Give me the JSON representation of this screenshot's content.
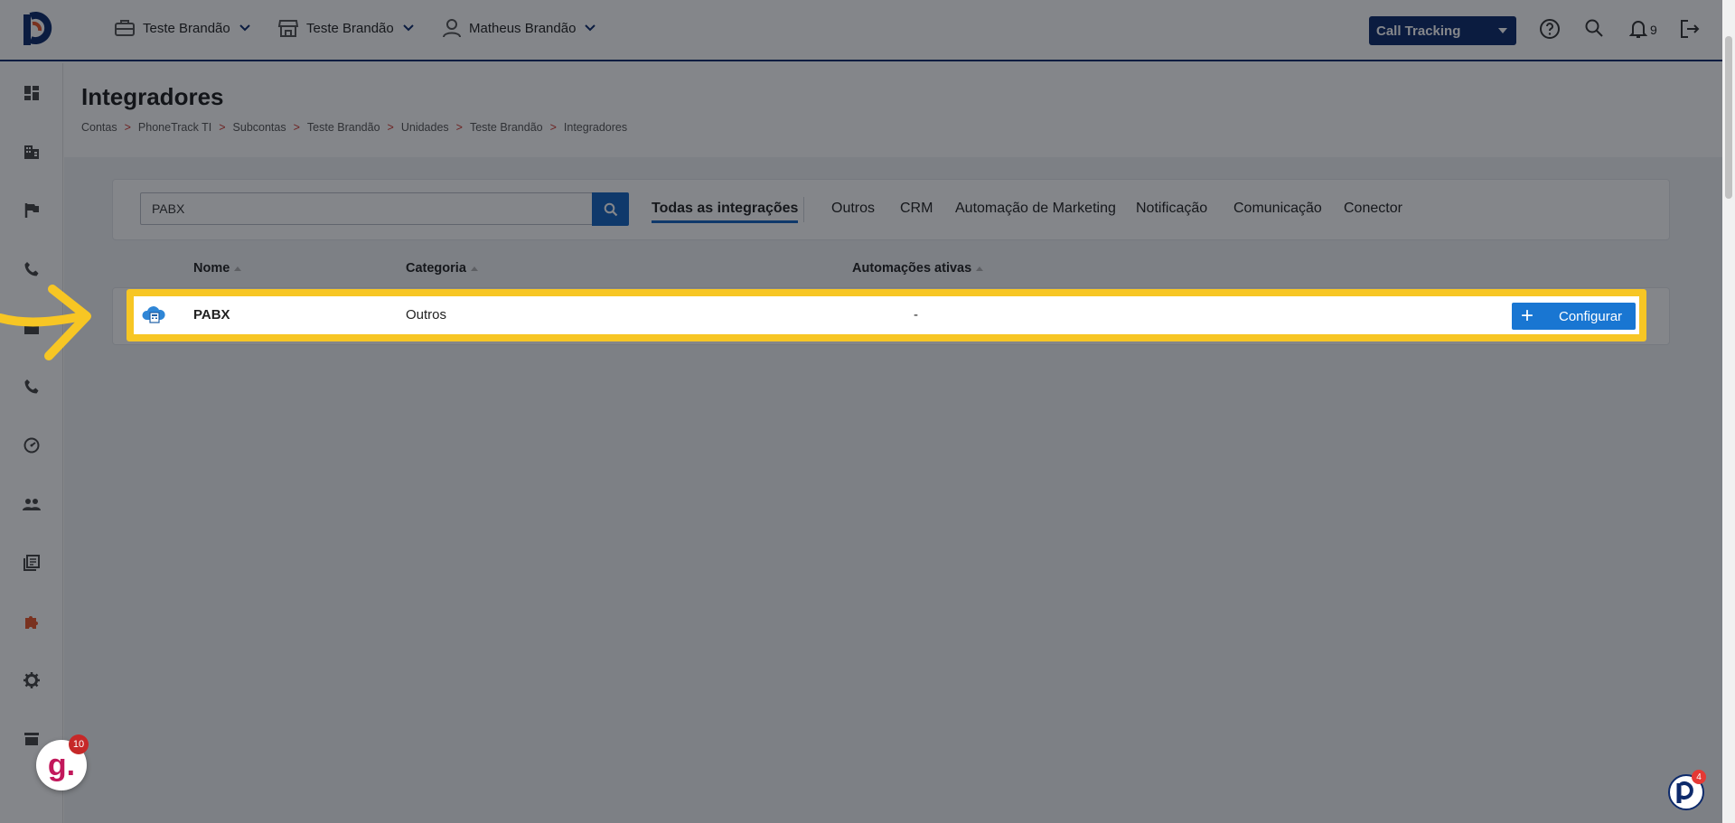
{
  "header": {
    "account_selector": "Teste Brandão",
    "store_selector": "Teste Brandão",
    "user_selector": "Matheus Brandão",
    "product_select": "Call Tracking",
    "notifications_count": "9"
  },
  "sidebar": {
    "items": [
      {
        "icon": "dashboard-icon"
      },
      {
        "icon": "building-icon"
      },
      {
        "icon": "flag-icon"
      },
      {
        "icon": "phone-icon"
      },
      {
        "icon": "inbox-icon"
      },
      {
        "icon": "phone-icon"
      },
      {
        "icon": "speed-icon"
      },
      {
        "icon": "people-icon"
      },
      {
        "icon": "library-icon"
      },
      {
        "icon": "puzzle-icon",
        "active": true
      },
      {
        "icon": "gear-icon"
      },
      {
        "icon": "store-icon"
      }
    ]
  },
  "page": {
    "title": "Integradores",
    "breadcrumb": [
      "Contas",
      "PhoneTrack TI",
      "Subcontas",
      "Teste Brandão",
      "Unidades",
      "Teste Brandão",
      "Integradores"
    ]
  },
  "filter": {
    "search_value": "PABX",
    "tabs": [
      "Todas as integrações",
      "Outros",
      "CRM",
      "Automação de Marketing",
      "Notificação",
      "Comunicação",
      "Conector"
    ],
    "active_tab": "Todas as integrações"
  },
  "table": {
    "columns": [
      "Nome",
      "Categoria",
      "Automações ativas"
    ],
    "rows": [
      {
        "name": "PABX",
        "category": "Outros",
        "automations": "-",
        "action": "Configurar"
      }
    ]
  },
  "widgets": {
    "g_letter": "g.",
    "g_count": "10",
    "p_count": "4"
  },
  "colors": {
    "brand_navy": "#0d2a6b",
    "primary_blue": "#1976d2",
    "highlight_yellow": "#f7c624",
    "breadcrumb_separator": "#d0342c"
  }
}
